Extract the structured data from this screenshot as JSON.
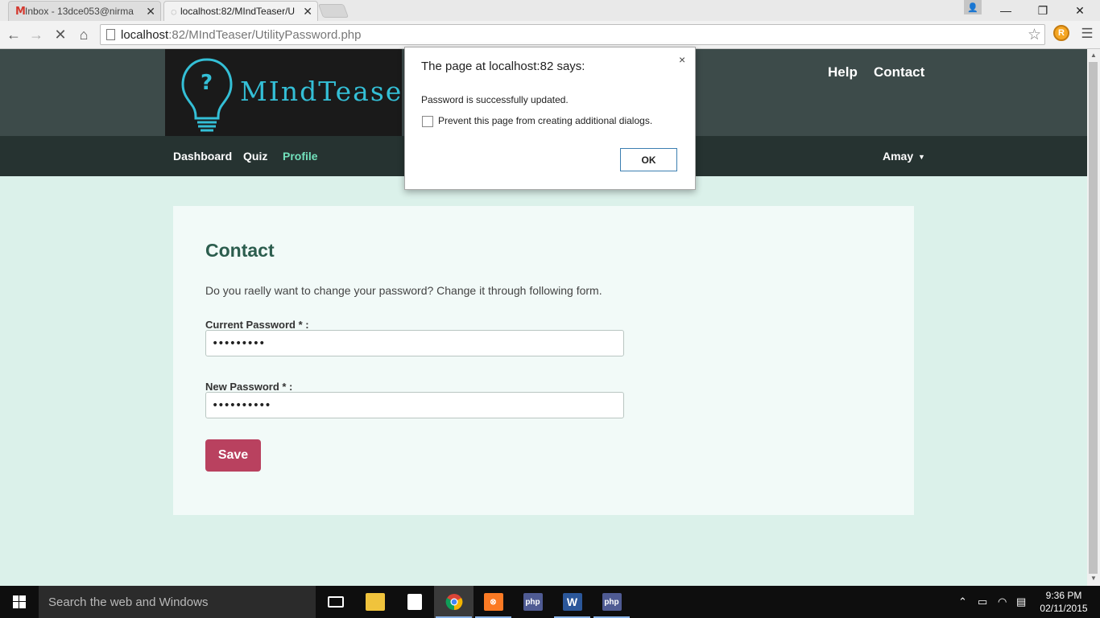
{
  "browser": {
    "tabs": [
      {
        "label": "Inbox - 13dce053@nirma",
        "icon": "gmail-icon"
      },
      {
        "label": "localhost:82/MIndTeaser/U",
        "icon": "loading-icon"
      }
    ],
    "url_host": "localhost",
    "url_path": ":82/MIndTeaser/UtilityPassword.php"
  },
  "site": {
    "logo_text": "MIndTeaser",
    "top_links": [
      "Help",
      "Contact"
    ],
    "nav": {
      "dashboard": "Dashboard",
      "quiz": "Quiz",
      "profile": "Profile",
      "user": "Amay"
    },
    "accent_color": "#72e1bc"
  },
  "content": {
    "title": "Contact",
    "intro": "Do you raelly want to change your password? Change it through following form.",
    "current_label": "Current Password * :",
    "current_value": "•••••••••",
    "new_label": "New Password * :",
    "new_value": "••••••••••",
    "save_label": "Save",
    "save_color": "#b9415f"
  },
  "dialog": {
    "title": "The page at localhost:82 says:",
    "message": "Password is successfully updated.",
    "checkbox_label": "Prevent this page from creating additional dialogs.",
    "checked": false,
    "ok_label": "OK",
    "close": "×"
  },
  "taskbar": {
    "search_placeholder": "Search the web and Windows",
    "apps": [
      "task-view-icon",
      "file-explorer-icon",
      "store-icon",
      "chrome-icon",
      "xampp-icon",
      "php-icon",
      "word-icon",
      "php-icon"
    ],
    "time": "9:36 PM",
    "date": "02/11/2015"
  }
}
